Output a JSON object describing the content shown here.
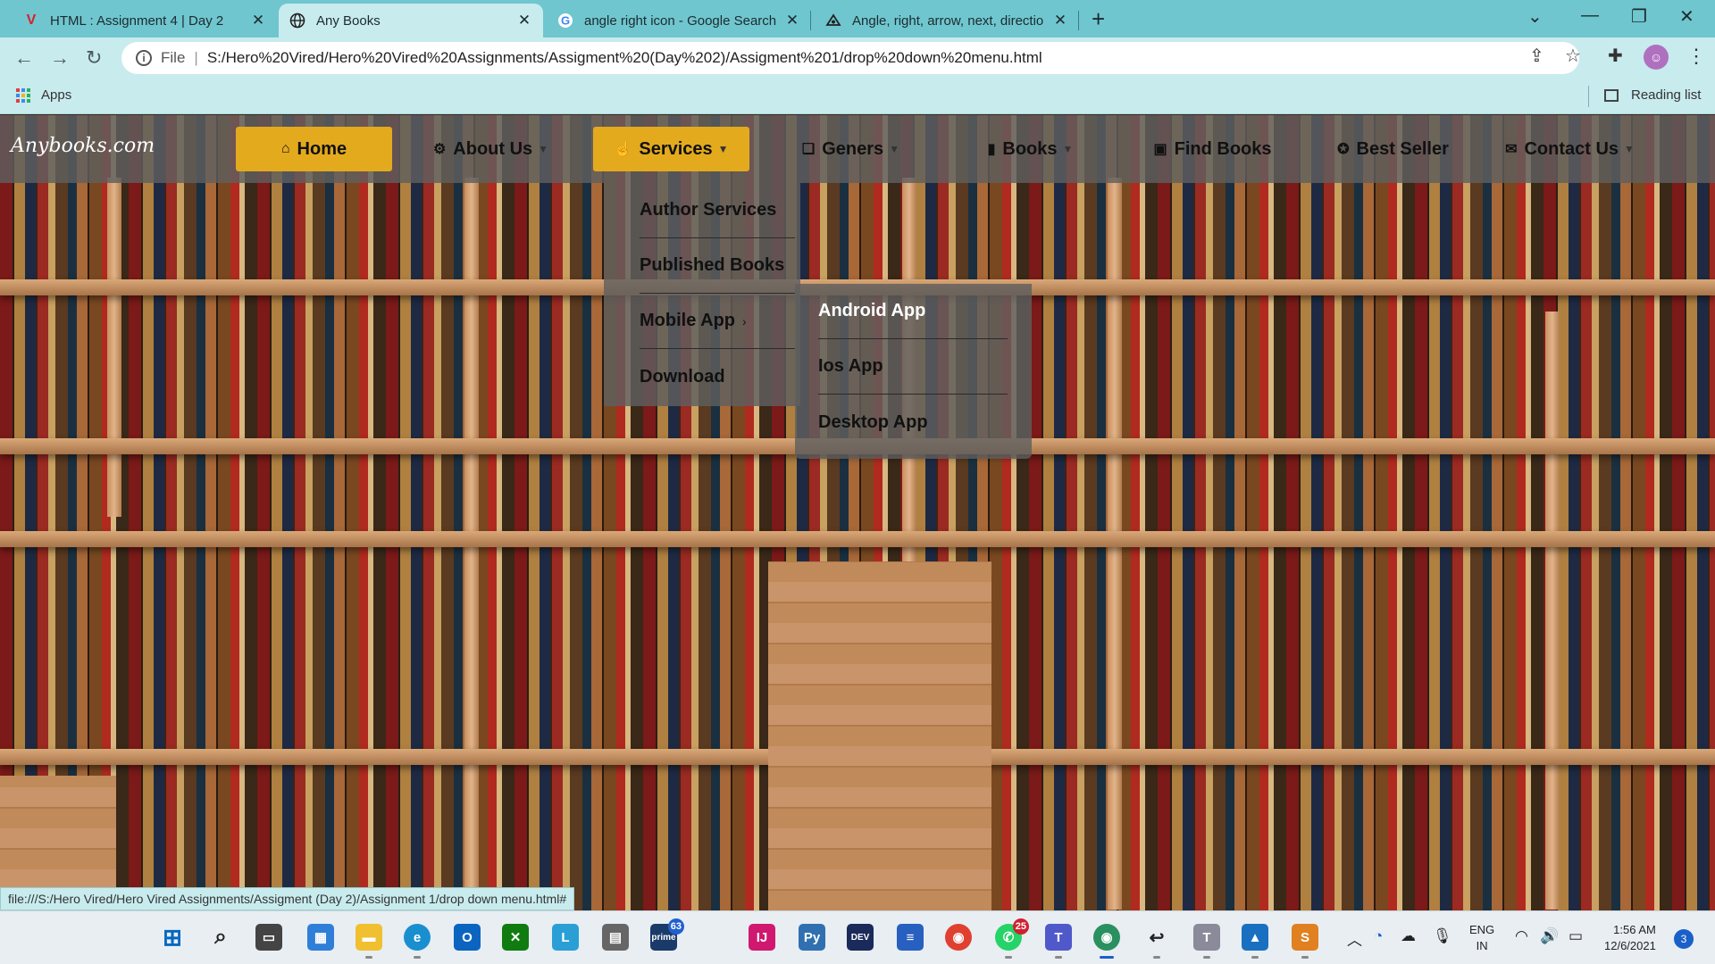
{
  "tabs": [
    {
      "title": "HTML : Assignment 4 | Day 2",
      "icon": "vired-logo-icon",
      "active": false
    },
    {
      "title": "Any Books",
      "icon": "globe-icon",
      "active": true
    },
    {
      "title": "angle right icon - Google Search",
      "icon": "google-icon",
      "active": false
    },
    {
      "title": "Angle, right, arrow, next, directio",
      "icon": "iconscout-icon",
      "active": false
    }
  ],
  "toolbar": {
    "file_label": "File",
    "url": "S:/Hero%20Vired/Hero%20Vired%20Assignments/Assigment%20(Day%202)/Assigment%201/drop%20down%20menu.html"
  },
  "bookmarks": {
    "apps_label": "Apps",
    "reading_list_label": "Reading list"
  },
  "site": {
    "logo": "Anybooks.com",
    "nav": [
      {
        "label": "Home",
        "icon": "home-icon",
        "highlighted": true,
        "dropdown": false
      },
      {
        "label": "About Us",
        "icon": "gear-icon",
        "highlighted": false,
        "dropdown": true
      },
      {
        "label": "Services",
        "icon": "hand-icon",
        "highlighted": true,
        "dropdown": true
      },
      {
        "label": "Geners",
        "icon": "books-icon",
        "highlighted": false,
        "dropdown": true
      },
      {
        "label": "Books",
        "icon": "book-open-icon",
        "highlighted": false,
        "dropdown": true
      },
      {
        "label": "Find Books",
        "icon": "search-book-icon",
        "highlighted": false,
        "dropdown": false
      },
      {
        "label": "Best Seller",
        "icon": "award-icon",
        "highlighted": false,
        "dropdown": false
      },
      {
        "label": "Contact Us",
        "icon": "handshake-icon",
        "highlighted": false,
        "dropdown": true
      }
    ],
    "services_dropdown": [
      "Author Services",
      "Published Books",
      "Mobile App",
      "Download"
    ],
    "mobile_submenu": [
      "Android App",
      "Ios App",
      "Desktop App"
    ],
    "colors": {
      "accent": "#e3aa1e",
      "nav_bg": "#5f5f5f"
    }
  },
  "status_url": "file:///S:/Hero Vired/Hero Vired Assignments/Assigment (Day 2)/Assignment 1/drop down menu.html#",
  "taskbar": {
    "badges": {
      "prime": "63",
      "whatsapp": "25",
      "notifications": "3"
    },
    "lang_top": "ENG",
    "lang_bottom": "IN",
    "time": "1:56 AM",
    "date": "12/6/2021"
  }
}
